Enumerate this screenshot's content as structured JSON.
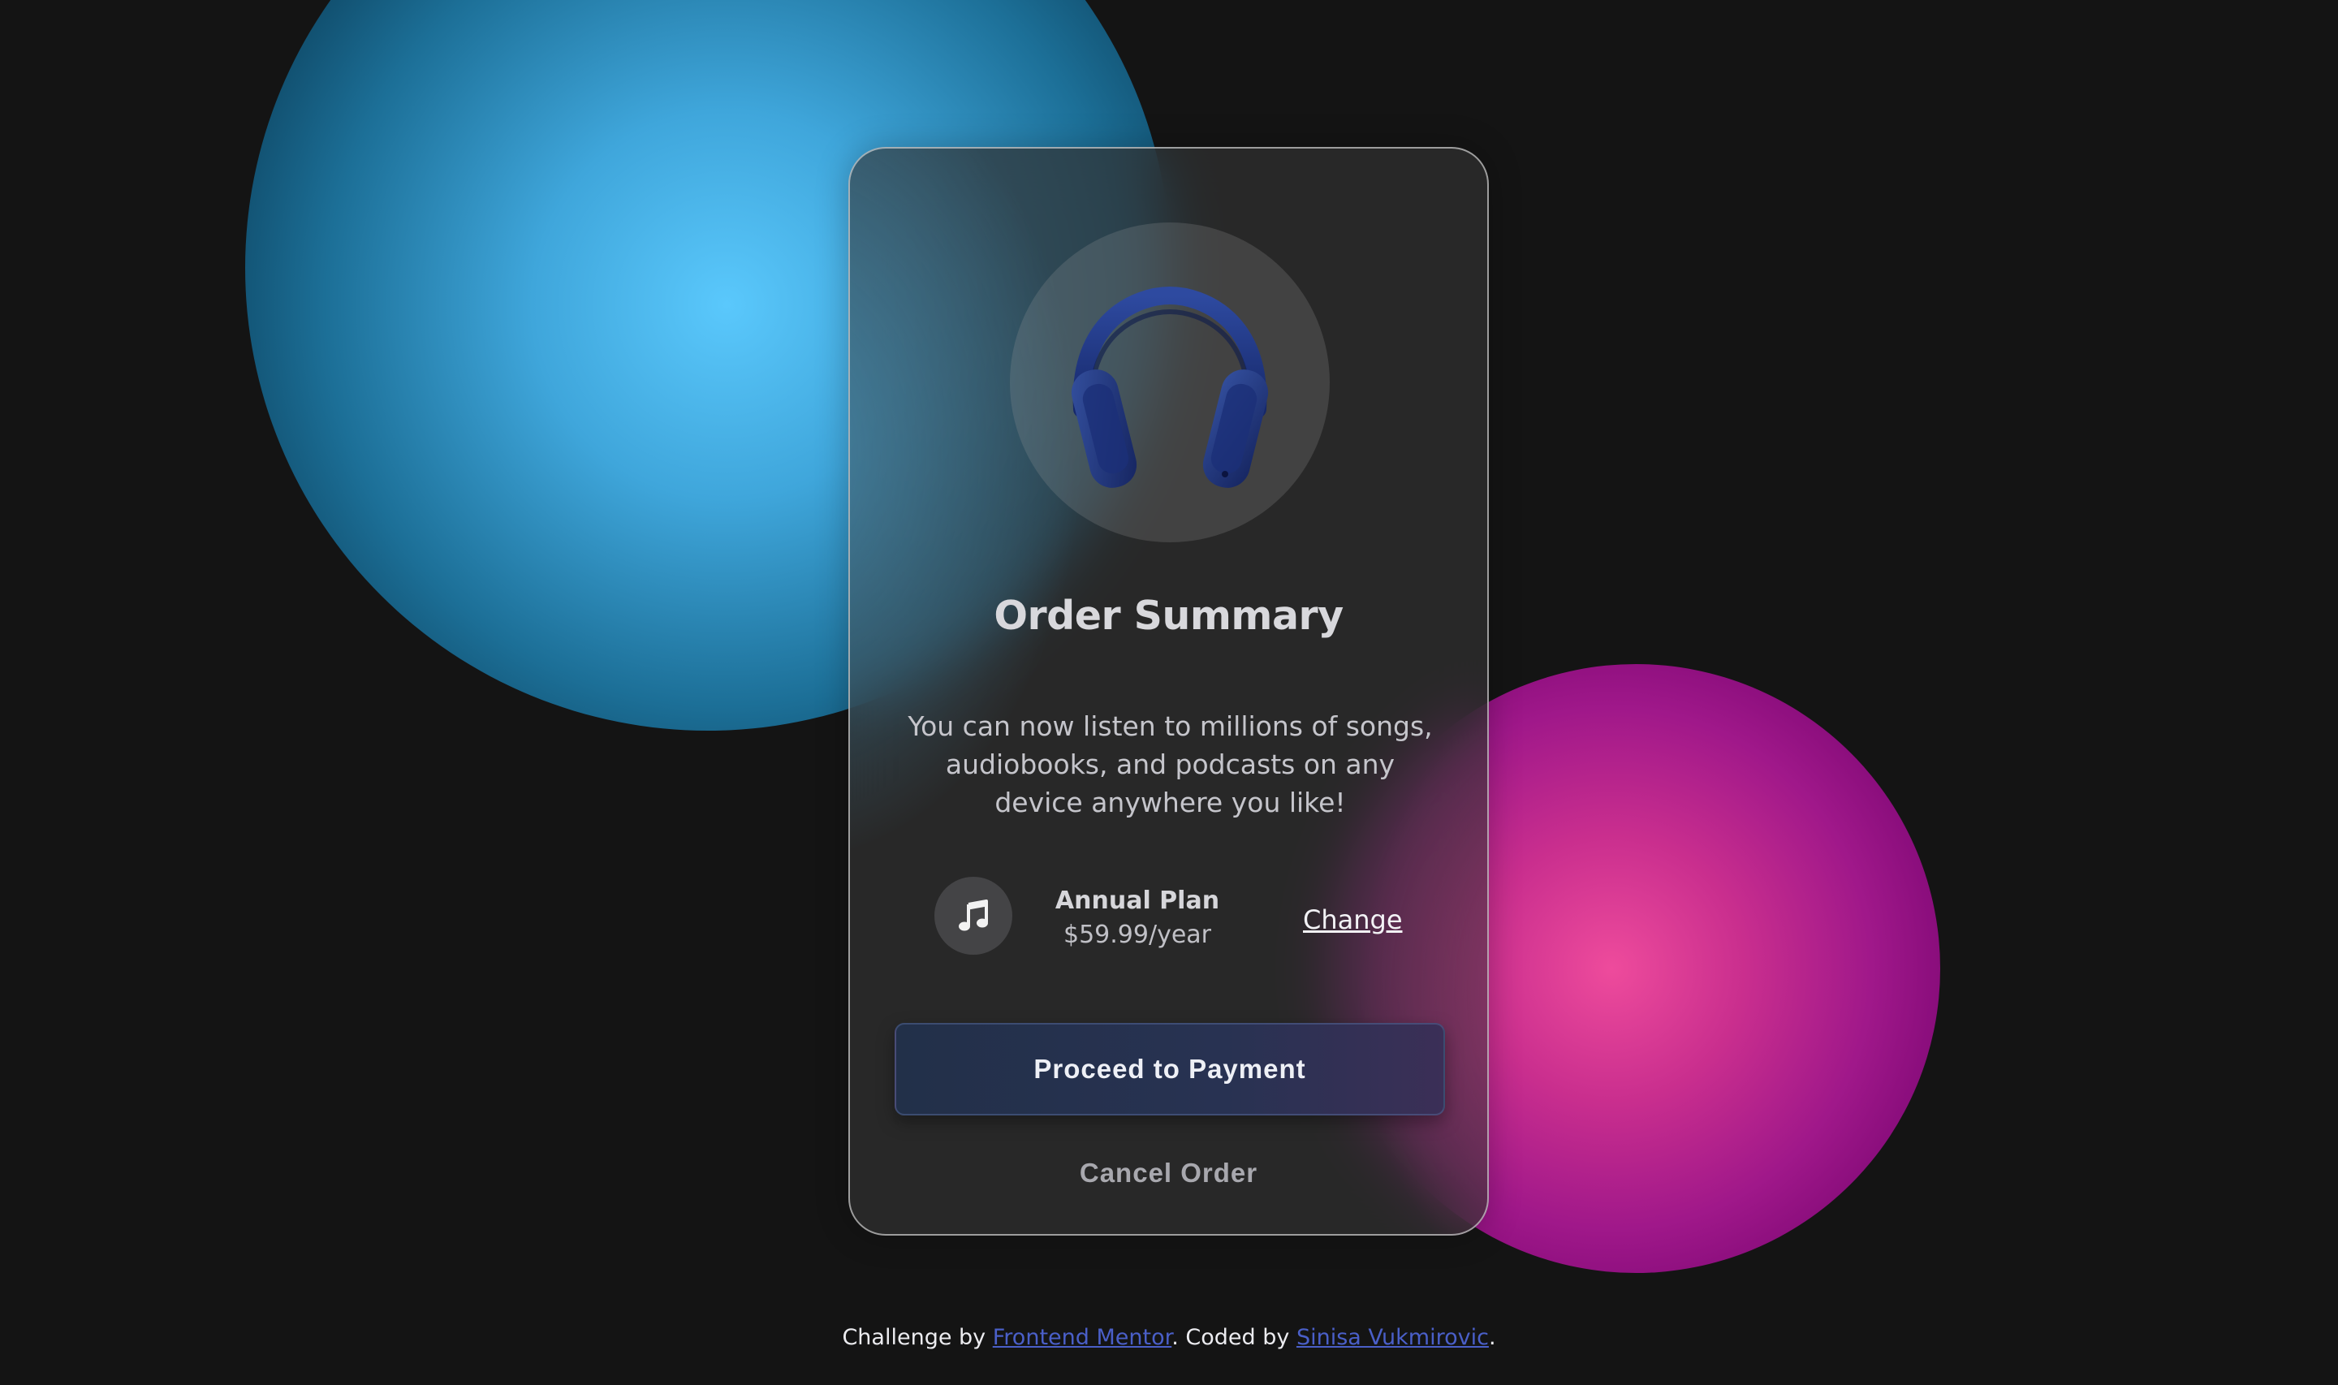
{
  "colors": {
    "background": "#141414",
    "orb_blue": "#5ac8fc",
    "orb_pink": "#ee4b9c",
    "button": "#283252",
    "link": "#4a5fc8"
  },
  "hero": {
    "image": "headphones-icon"
  },
  "card": {
    "title": "Order Summary",
    "description": "You can now listen to millions of songs, audiobooks, and podcasts on any device anywhere you like!",
    "plan": {
      "icon": "music-note-icon",
      "name": "Annual Plan",
      "price": "$59.99/year",
      "change_label": "Change"
    },
    "proceed_label": "Proceed to Payment",
    "cancel_label": "Cancel Order"
  },
  "footer": {
    "prefix": "Challenge by ",
    "link1": "Frontend Mentor",
    "middle": ". Coded by ",
    "link2": "Sinisa Vukmirovic",
    "suffix": "."
  }
}
